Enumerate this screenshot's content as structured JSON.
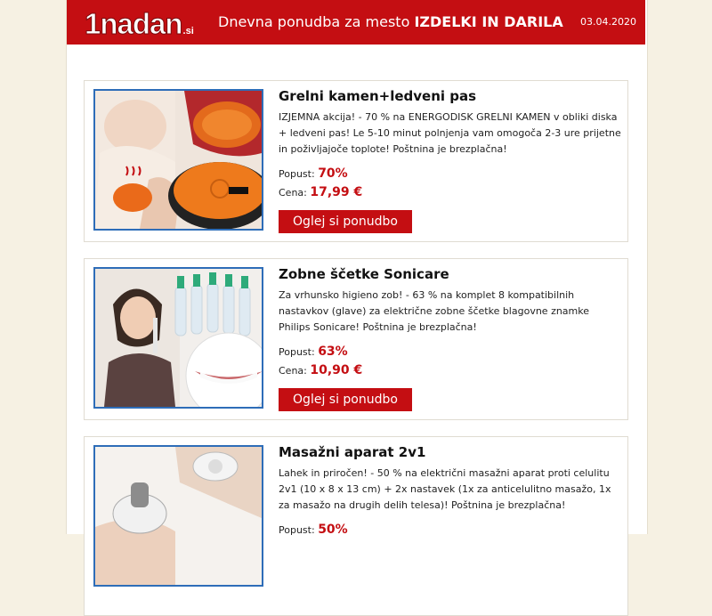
{
  "header": {
    "logo_text": "1nadan",
    "logo_tld": ".si",
    "title_prefix": "Dnevna ponudba za mesto ",
    "title_city": "IZDELKI IN DARILA",
    "date": "03.04.2020"
  },
  "colors": {
    "brand_red": "#c40e12",
    "image_border_blue": "#2e6db8",
    "page_background": "#f6f1e3"
  },
  "offers": [
    {
      "title": "Grelni kamen+ledveni pas",
      "description": "IZJEMNA akcija! - 70 % na ENERGODISK GRELNI KAMEN v obliki diska + ledveni pas! Le 5-10 minut polnjenja vam omogoča 2-3 ure prijetne in poživljajoče toplote! Poštnina je brezplačna!",
      "discount_label": "Popust:",
      "discount_value": "70%",
      "price_label": "Cena:",
      "price_value": "17,99 €",
      "button_label": "Oglej si ponudbo",
      "image_icon": "heating-stone-photo"
    },
    {
      "title": "Zobne ščetke Sonicare",
      "description": "Za vrhunsko higieno zob! - 63 % na komplet 8 kompatibilnih nastavkov (glave) za električne zobne ščetke blagovne znamke Philips Sonicare! Poštnina je brezplačna!",
      "discount_label": "Popust:",
      "discount_value": "63%",
      "price_label": "Cena:",
      "price_value": "10,90 €",
      "button_label": "Oglej si ponudbo",
      "image_icon": "toothbrush-heads-photo"
    },
    {
      "title": "Masažni aparat 2v1",
      "description": "Lahek in priročen! - 50 % na električni masažni aparat proti celulitu 2v1 (10 x 8 x 13 cm) + 2x nastavek (1x za anticelulitno masažo, 1x za masažo na drugih delih telesa)! Poštnina je brezplačna!",
      "discount_label": "Popust:",
      "discount_value": "50%",
      "image_icon": "massager-photo"
    }
  ]
}
